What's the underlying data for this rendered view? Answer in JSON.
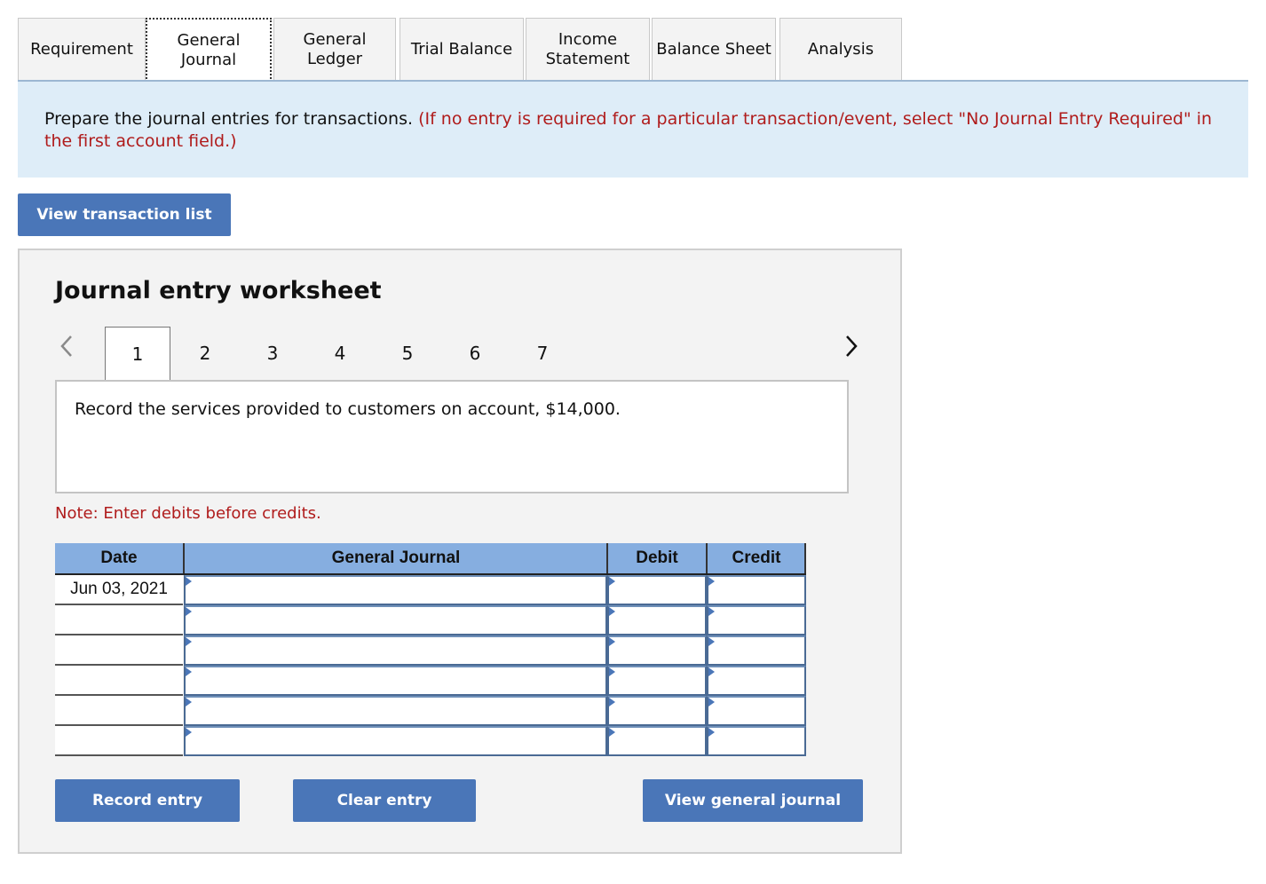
{
  "tabs": [
    {
      "label": "Requirement",
      "active": false
    },
    {
      "label": "General\nJournal",
      "active": true
    },
    {
      "label": "General\nLedger",
      "active": false
    },
    {
      "label": "Trial Balance",
      "active": false
    },
    {
      "label": "Income\nStatement",
      "active": false
    },
    {
      "label": "Balance Sheet",
      "active": false
    },
    {
      "label": "Analysis",
      "active": false
    }
  ],
  "instructions": {
    "main": "Prepare the journal entries for transactions. ",
    "note": "(If no entry is required for a particular transaction/event, select \"No Journal Entry Required\" in the first account field.)"
  },
  "view_transaction_list_label": "View transaction list",
  "worksheet": {
    "title": "Journal entry worksheet",
    "pages": [
      "1",
      "2",
      "3",
      "4",
      "5",
      "6",
      "7"
    ],
    "active_page": "1",
    "transaction_text": "Record the services provided to customers on account, $14,000.",
    "note": "Note: Enter debits before credits.",
    "table": {
      "headers": {
        "date": "Date",
        "account": "General Journal",
        "debit": "Debit",
        "credit": "Credit"
      },
      "rows": [
        {
          "date": "Jun 03, 2021",
          "account": "",
          "debit": "",
          "credit": ""
        },
        {
          "date": "",
          "account": "",
          "debit": "",
          "credit": ""
        },
        {
          "date": "",
          "account": "",
          "debit": "",
          "credit": ""
        },
        {
          "date": "",
          "account": "",
          "debit": "",
          "credit": ""
        },
        {
          "date": "",
          "account": "",
          "debit": "",
          "credit": ""
        },
        {
          "date": "",
          "account": "",
          "debit": "",
          "credit": ""
        }
      ]
    },
    "buttons": {
      "record": "Record entry",
      "clear": "Clear entry",
      "view_general_journal": "View general journal"
    }
  },
  "colors": {
    "accent_button": "#4a76b8",
    "instruction_bg": "#deedf8",
    "note_red": "#b01c1c",
    "table_header": "#86aee0"
  },
  "icons": {
    "prev": "chevron-left-icon",
    "next": "chevron-right-icon"
  }
}
